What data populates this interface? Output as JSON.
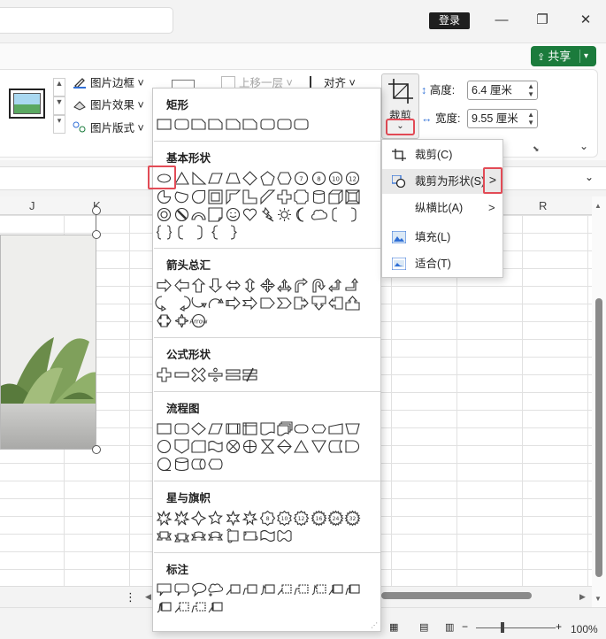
{
  "titlebar": {
    "login": "登录",
    "minimize": "—",
    "restore": "❐",
    "close": "✕"
  },
  "ribbon": {
    "share": "共享",
    "picture_border": "图片边框",
    "picture_effects": "图片效果",
    "picture_layout": "图片版式",
    "bring_forward": "上移一层",
    "align": "对齐",
    "crop": "裁剪",
    "height_label": "高度:",
    "height_value": "6.4 厘米",
    "width_label": "宽度:",
    "width_value": "9.55 厘米"
  },
  "columns": [
    "J",
    "K",
    "R"
  ],
  "shapes_panel": {
    "sections": [
      {
        "title": "矩形"
      },
      {
        "title": "基本形状"
      },
      {
        "title": "箭头总汇"
      },
      {
        "title": "公式形状"
      },
      {
        "title": "流程图"
      },
      {
        "title": "星与旗帜"
      },
      {
        "title": "标注"
      }
    ]
  },
  "crop_menu": {
    "items": [
      {
        "label": "裁剪(C)",
        "icon": "crop-icon"
      },
      {
        "label": "裁剪为形状(S)",
        "icon": "crop-to-shape-icon",
        "has_submenu": true,
        "highlighted": true
      },
      {
        "label": "纵横比(A)",
        "icon": "",
        "has_submenu": true
      },
      {
        "label": "填充(L)",
        "icon": "fill-icon"
      },
      {
        "label": "适合(T)",
        "icon": "fit-icon"
      }
    ]
  },
  "status": {
    "zoom": "100%"
  }
}
